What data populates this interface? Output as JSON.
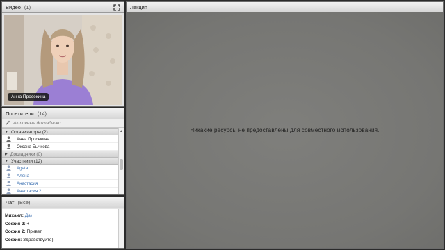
{
  "video": {
    "title": "Видео",
    "count": "(1)",
    "speaker_name": "Анна Просекина"
  },
  "attendees": {
    "title": "Посетители",
    "count": "(14)",
    "active_speakers_label": "Активные докладчики",
    "groups": {
      "organizers": {
        "label": "Организаторы (2)",
        "members": [
          "Анна Просекина",
          "Оксана Бычкова"
        ]
      },
      "presenters": {
        "label": "Докладчики (0)"
      },
      "participants": {
        "label": "Участники (12)",
        "members": [
          "Agata",
          "Алёна",
          "Анастасия",
          "Анастасия 2"
        ]
      }
    }
  },
  "chat": {
    "title": "Чат",
    "scope": "(Все)",
    "messages": [
      {
        "author": "Михаил:",
        "text": "Да)"
      },
      {
        "author": "София 2:",
        "text": "+"
      },
      {
        "author": "София 2:",
        "text": "Привет"
      },
      {
        "author": "София:",
        "text": "Здравствуйте)"
      }
    ]
  },
  "lecture": {
    "title": "Лекция",
    "empty_message": "Никакие ресурсы не предоставлены для совместного использования."
  },
  "colors": {
    "participant_text": "#3a6fb0",
    "stage_background": "#7a7a77",
    "shirt": "#9b7fd4"
  },
  "icons": [
    "expand-icon",
    "wand-icon",
    "host-person-icon",
    "participant-person-icon",
    "triangle-down-icon",
    "triangle-right-icon"
  ]
}
